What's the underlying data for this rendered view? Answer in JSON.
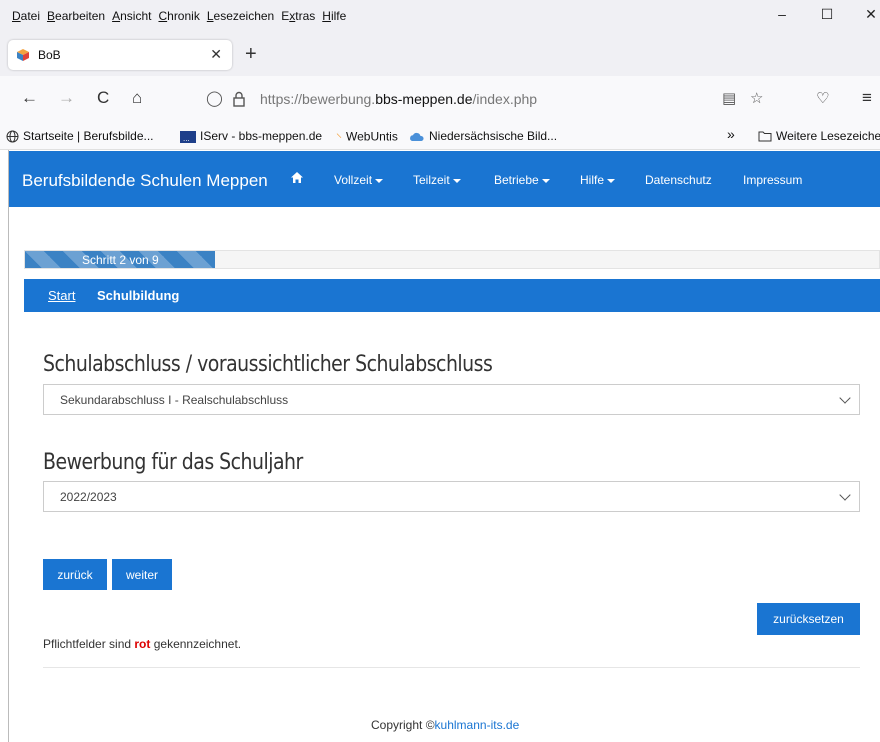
{
  "menubar": {
    "items": [
      {
        "u": "D",
        "rest": "atei"
      },
      {
        "u": "B",
        "rest": "earbeiten"
      },
      {
        "u": "A",
        "rest": "nsicht"
      },
      {
        "u": "C",
        "rest": "hronik"
      },
      {
        "u": "L",
        "rest": "esezeichen"
      },
      {
        "pre": "E",
        "u": "x",
        "rest": "tras"
      },
      {
        "u": "H",
        "rest": "ilfe"
      }
    ],
    "minimize": "–",
    "maximize": "☐",
    "close": "✕"
  },
  "tab": {
    "title": "BoB",
    "close": "✕",
    "new_tab": "+"
  },
  "navbar": {
    "back": "←",
    "forward": "→",
    "reload": "C",
    "home": "⌂",
    "shield": "◯",
    "lock": "🔒",
    "url_prefix": "https://bewerbung.",
    "url_domain": "bbs-meppen.de",
    "url_path": "/index.php",
    "reader": "▤",
    "star": "☆",
    "pocket": "♡",
    "menu": "≡"
  },
  "bookmarks": {
    "items": [
      "Startseite | Berufsbilde...",
      "IServ - bbs-meppen.de",
      "WebUntis",
      "Niedersächsische Bild..."
    ],
    "overflow": "»",
    "other": "Weitere Lesezeichen"
  },
  "site": {
    "brand": "Berufsbildende Schulen Meppen",
    "home_icon": "⌂",
    "nav": [
      "Vollzeit",
      "Teilzeit",
      "Betriebe",
      "Hilfe",
      "Datenschutz",
      "Impressum"
    ]
  },
  "progress": {
    "label": "Schritt 2 von 9",
    "step": 2,
    "total": 9
  },
  "breadcrumb": {
    "start": "Start",
    "current": "Schulbildung"
  },
  "form": {
    "q1_label": "Schulabschluss / voraussichtlicher Schulabschluss",
    "q1_value": "Sekundarabschluss I - Realschulabschluss",
    "q2_label": "Bewerbung für das Schuljahr",
    "q2_value": "2022/2023",
    "back_label": "zurück",
    "next_label": "weiter",
    "reset_label": "zurücksetzen",
    "required_pre": "Pflichtfelder sind ",
    "required_red": "rot",
    "required_post": " gekennzeichnet."
  },
  "footer": {
    "copyright_text": "Copyright ©",
    "copyright_link": "kuhlmann-its.de"
  },
  "colors": {
    "accent": "#1a75d2",
    "required": "#dd0000"
  }
}
